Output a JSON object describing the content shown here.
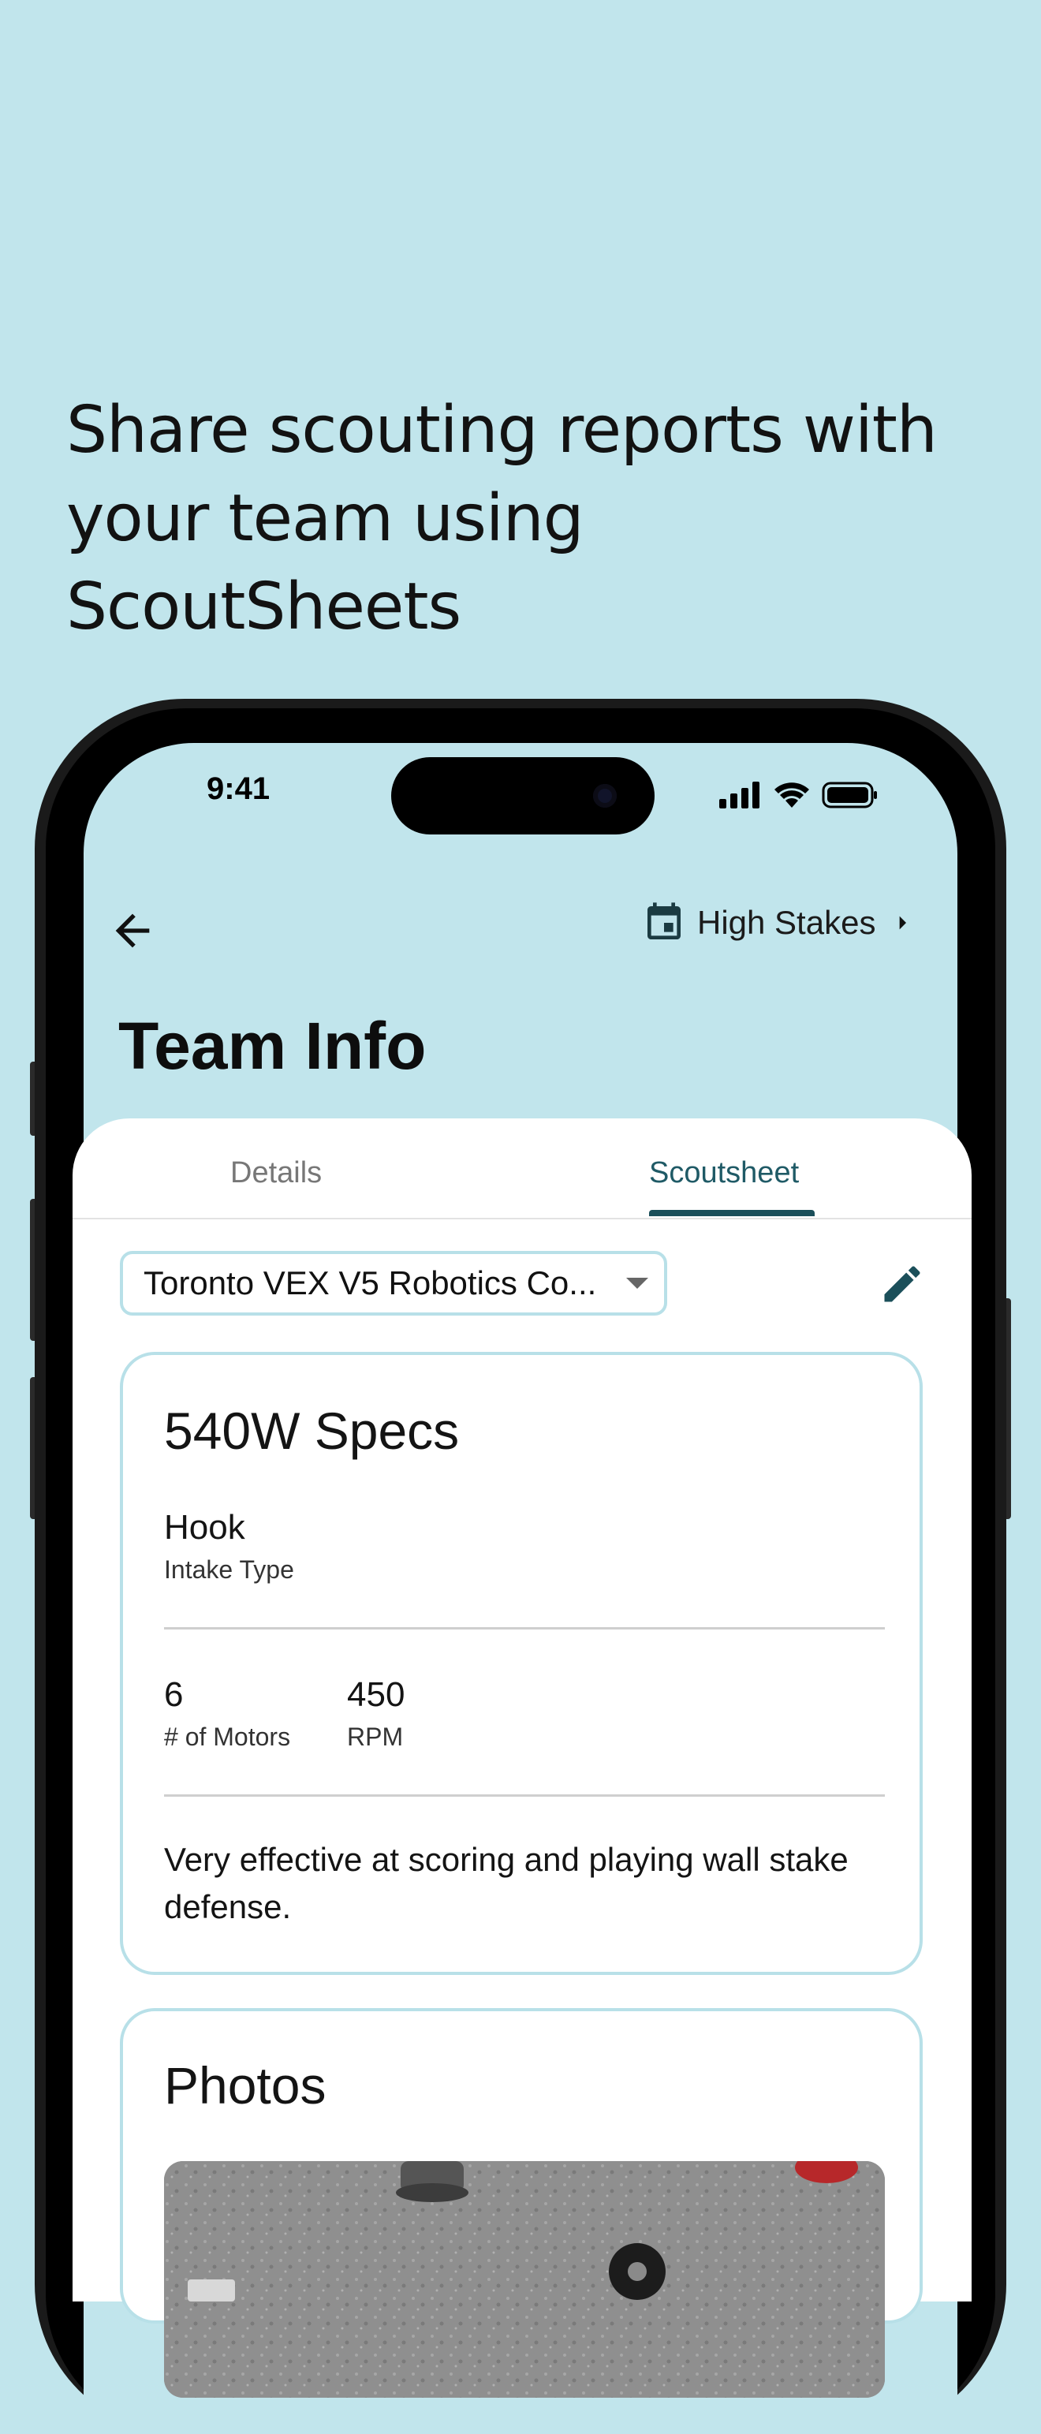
{
  "headline": {
    "line1": "Share scouting reports with",
    "line2": "your team using ScoutSheets"
  },
  "status_bar": {
    "time": "9:41"
  },
  "header": {
    "event_label": "High Stakes",
    "title": "Team Info"
  },
  "tabs": [
    {
      "label": "Details",
      "selected": false
    },
    {
      "label": "Scoutsheet",
      "selected": true
    }
  ],
  "scoutsheet_selector": {
    "value": "Toronto VEX V5 Robotics Co..."
  },
  "specs_card": {
    "title": "540W Specs",
    "intake_value": "Hook",
    "intake_label": "Intake Type",
    "motors_value": "6",
    "motors_label": "# of Motors",
    "rpm_value": "450",
    "rpm_label": "RPM",
    "notes": "Very effective at scoring and playing wall stake defense."
  },
  "photos_card": {
    "title": "Photos"
  },
  "colors": {
    "background": "#c1e5ec",
    "accent": "#1b4f5a",
    "card_border": "#b8e0e8"
  }
}
